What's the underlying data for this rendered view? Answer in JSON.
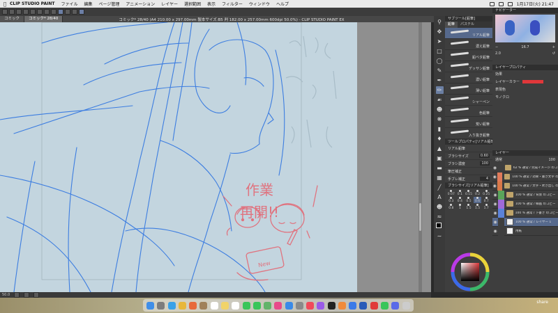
{
  "menubar": {
    "app_name": "CLIP STUDIO PAINT",
    "items": [
      "ファイル",
      "編集",
      "ページ管理",
      "アニメーション",
      "レイヤー",
      "選択範囲",
      "表示",
      "フィルター",
      "ウィンドウ",
      "ヘルプ"
    ],
    "clock": "1月17日(火) 21:47"
  },
  "tabs": [
    "コミック",
    "コミック* 28/40"
  ],
  "window_title": "コミック* 28/40 (A4 210.00 x 297.00mm 製本サイズ:B5 判 182.00 x 257.00mm 600dpi 50.0%) - CLIP STUDIO PAINT EX",
  "canvas": {
    "handwriting_line1": "作業",
    "handwriting_line2": "再開!!",
    "card_label": "New",
    "status_zoom": "50.0",
    "ink_color": "#e0737f",
    "sketch_color": "#3c7de0",
    "paper_color": "#c3d5df"
  },
  "subtool_panel": {
    "header": "サブツール[鉛筆]",
    "tabs": [
      "鉛筆",
      "パステル"
    ],
    "brushes": [
      "リアル鉛筆",
      "濃え鉛筆",
      "鉛ベタ鉛筆",
      "デッサン鉛筆",
      "濃い鉛筆",
      "薄い鉛筆",
      "シャーペン",
      "色鉛筆",
      "荒い鉛筆",
      "入り抜き鉛筆"
    ]
  },
  "tool_property": {
    "header": "ツールプロパティ[リアル鉛筆]",
    "name_label": "リアル鉛筆",
    "rows": [
      {
        "label": "ブラシサイズ",
        "value": "0.60"
      },
      {
        "label": "ブラシ濃度",
        "value": "100"
      },
      {
        "label": "筆圧補正",
        "value": ""
      },
      {
        "label": "手ブレ補正",
        "value": "4"
      }
    ]
  },
  "brush_size_panel": {
    "header": "ブラシサイズ[リアル鉛筆]",
    "sizes": [
      "0.07",
      "0.1",
      "0.15",
      "0.2",
      "0.25",
      "0.3",
      "0.4",
      "0.5",
      "0.6",
      "0.7",
      "0.8",
      "1",
      "1.5",
      "1.5",
      "1.7"
    ],
    "selected": "0.6"
  },
  "navigator": {
    "header": "ナビゲーター",
    "zoom": "16.7",
    "rotation": "2.0"
  },
  "layer_property": {
    "header": "レイヤープロパティ",
    "effect_label": "効果",
    "layer_color_label": "レイヤーカラー",
    "display_color_label": "表現色",
    "mode": "モノクロ",
    "layer_color": "#e0373a"
  },
  "layer_panel": {
    "header": "レイヤー",
    "blend": "通常",
    "opacity": "100",
    "layers": [
      {
        "text": "62 % 通常 / 完成イメージ のコピー",
        "color": "#3e3e3e",
        "type": "folder"
      },
      {
        "text": "100 % 通常 / 効果・書き文字 のコピー",
        "color": "#e07a5a",
        "type": "folder"
      },
      {
        "text": "100 % 通常 / 文字・吹き出し のコピー",
        "color": "#d97848",
        "type": "folder"
      },
      {
        "text": "100 % 通常 / 背景 のコピー",
        "color": "#5aa55a",
        "type": "folder"
      },
      {
        "text": "100 % 通常 / 線画 のコピー",
        "color": "#9f6ad8",
        "type": "folder"
      },
      {
        "text": "100 % 通常 / 下書き のコピー",
        "color": "#5b82d9",
        "type": "folder"
      },
      {
        "text": "100 % 通常 / レイヤー 1",
        "color": "#3e3e3e",
        "type": "layer"
      },
      {
        "text": "用紙",
        "color": "#3e3e3e",
        "type": "paper"
      }
    ],
    "selected_index": 6
  },
  "dock": {
    "label": "share",
    "icons": [
      "finder",
      "launchpad",
      "safari",
      "chrome",
      "photos",
      "contacts",
      "calendar",
      "notes",
      "reminders",
      "facetime",
      "messages",
      "maps",
      "photos2",
      "app-store",
      "settings",
      "music",
      "podcasts",
      "tv",
      "books",
      "clip-studio",
      "word",
      "acrobat",
      "line",
      "discord",
      "trash"
    ],
    "colors": [
      "#3f8ee8",
      "#7d7d7d",
      "#3aa1e8",
      "#e8b73a",
      "#e86a3a",
      "#a0815a",
      "#ffffff",
      "#f1d36a",
      "#ffffff",
      "#3ac55a",
      "#3ac55a",
      "#62b36a",
      "#e84a8a",
      "#3a8ae8",
      "#8a8a8a",
      "#f04a5a",
      "#9a5ae8",
      "#222222",
      "#f08a3a",
      "#3a7ae8",
      "#2a5bb8",
      "#e03a3a",
      "#3ac55a",
      "#5a6ae8",
      "#cccccc"
    ]
  }
}
